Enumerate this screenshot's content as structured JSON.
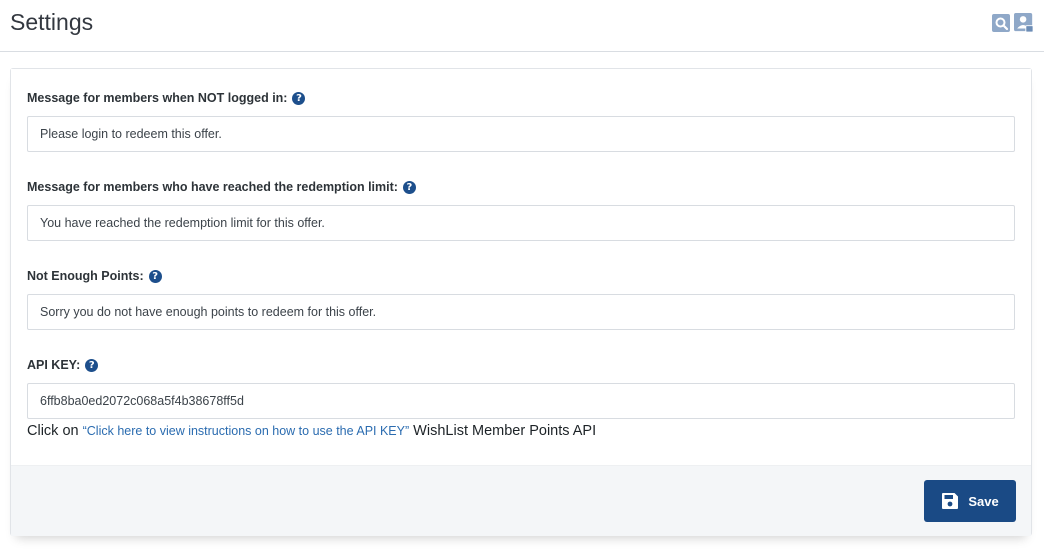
{
  "header": {
    "title": "Settings",
    "icons": [
      "search-icon",
      "user-icon"
    ]
  },
  "fields": [
    {
      "label": "Message for members when NOT logged in:",
      "value": "Please login to redeem this offer."
    },
    {
      "label": "Message for members who have reached the redemption limit:",
      "value": "You have reached the redemption limit for this offer."
    },
    {
      "label": "Not Enough Points:",
      "value": "Sorry you do not have enough points to redeem for this offer."
    },
    {
      "label": "API KEY:",
      "value": "6ffb8ba0ed2072c068a5f4b38678ff5d"
    }
  ],
  "help_glyph": "?",
  "api_note": {
    "prefix": "Click on ",
    "link_text": "“Click here to view instructions on how to use the API KEY”",
    "suffix": " WishList Member Points API"
  },
  "footer": {
    "save_label": "Save"
  },
  "colors": {
    "accent": "#1a4a85",
    "help_icon": "#1d4f8c",
    "link": "#2b6cb0",
    "footer_bg": "#f4f6f8"
  }
}
